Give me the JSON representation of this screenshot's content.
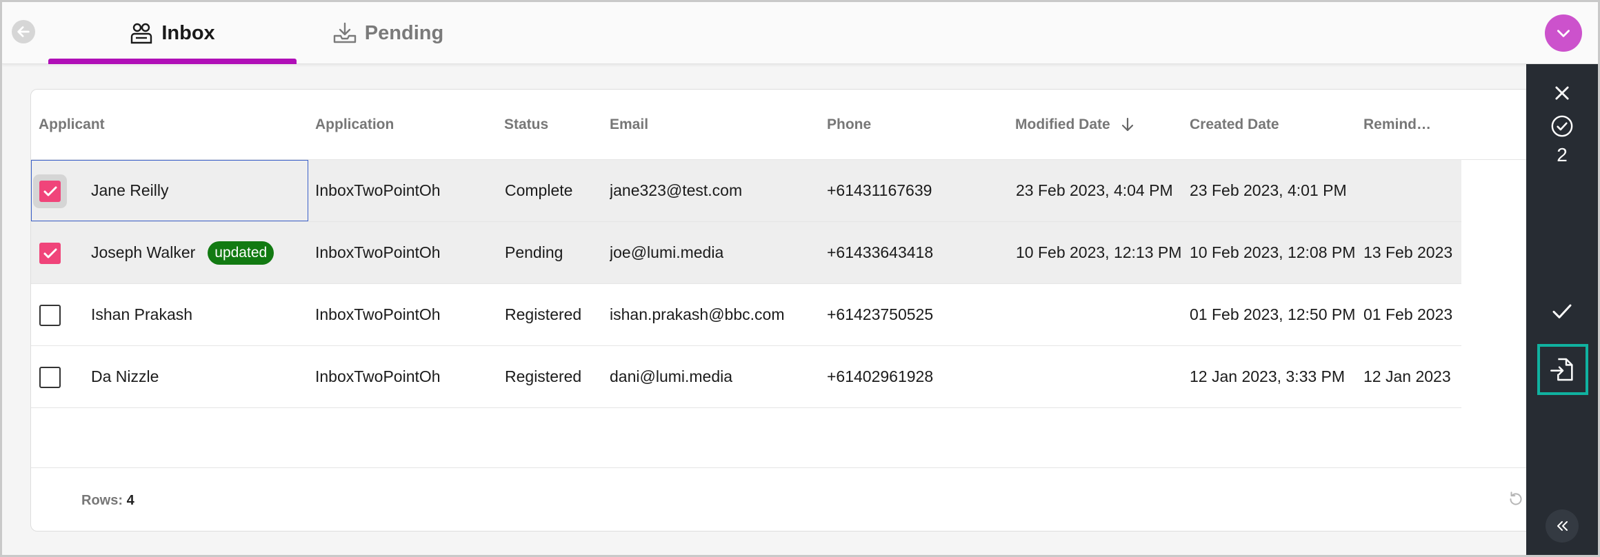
{
  "tabs": [
    {
      "label": "Inbox",
      "icon": "inbox-people-icon",
      "active": true
    },
    {
      "label": "Pending",
      "icon": "tray-download-icon",
      "active": false
    }
  ],
  "colors": {
    "accent": "#b00fb7",
    "avatar": "#cc52cc",
    "checkbox": "#f0447a",
    "badge": "#127a12",
    "panel": "#272c33",
    "highlight": "#10b2a0"
  },
  "table": {
    "headers": [
      "Applicant",
      "Application",
      "Status",
      "Email",
      "Phone",
      "Modified Date",
      "Created Date",
      "Remind…"
    ],
    "sort_column": "Modified Date",
    "sort_direction": "descending",
    "rows": [
      {
        "checked": true,
        "applicant": "Jane Reilly",
        "badge": "",
        "application": "InboxTwoPointOh",
        "status": "Complete",
        "email": "jane323@test.com",
        "phone": "+61431167639",
        "modified": "23 Feb 2023, 4:04 PM",
        "created": "23 Feb 2023, 4:01 PM",
        "reminder": ""
      },
      {
        "checked": true,
        "applicant": "Joseph Walker",
        "badge": "updated",
        "application": "InboxTwoPointOh",
        "status": "Pending",
        "email": "joe@lumi.media",
        "phone": "+61433643418",
        "modified": "10 Feb 2023, 12:13 PM",
        "created": "10 Feb 2023, 12:08 PM",
        "reminder": "13 Feb 2023"
      },
      {
        "checked": false,
        "applicant": "Ishan Prakash",
        "badge": "",
        "application": "InboxTwoPointOh",
        "status": "Registered",
        "email": "ishan.prakash@bbc.com",
        "phone": "+61423750525",
        "modified": "",
        "created": "01 Feb 2023, 12:50 PM",
        "reminder": "01 Feb 2023"
      },
      {
        "checked": false,
        "applicant": "Da Nizzle",
        "badge": "",
        "application": "InboxTwoPointOh",
        "status": "Registered",
        "email": "dani@lumi.media",
        "phone": "+61402961928",
        "modified": "",
        "created": "12 Jan 2023, 3:33 PM",
        "reminder": "12 Jan 2023"
      }
    ]
  },
  "footer": {
    "rows_label": "Rows:",
    "rows_count": "4"
  },
  "panel": {
    "selected_count": "2"
  }
}
